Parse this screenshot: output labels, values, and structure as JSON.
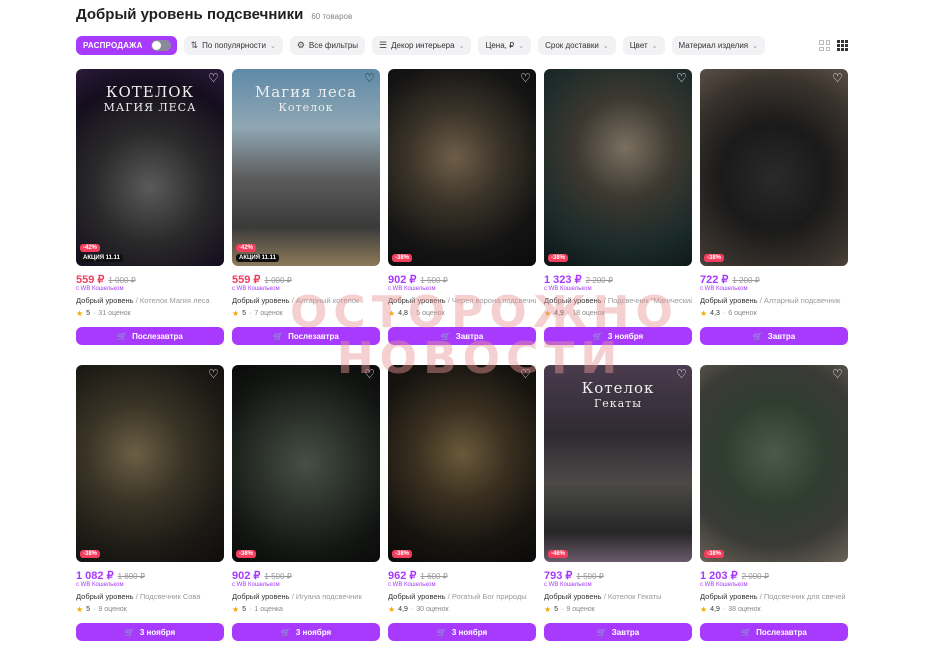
{
  "header": {
    "title": "Добрый уровень подсвечники",
    "count": "60 товаров"
  },
  "filters": {
    "sale_label": "РАСПРОДАЖА",
    "items": [
      {
        "label": "По популярности",
        "icon": "sort-icon"
      },
      {
        "label": "Все фильтры",
        "icon": "filter-icon"
      },
      {
        "label": "Декор интерьера",
        "icon": "list-icon"
      },
      {
        "label": "Цена, ₽",
        "icon": ""
      },
      {
        "label": "Срок доставки",
        "icon": ""
      },
      {
        "label": "Цвет",
        "icon": ""
      },
      {
        "label": "Материал изделия",
        "icon": ""
      }
    ]
  },
  "wallet_label": "с WB Кошельком",
  "products": [
    {
      "price": "559 ₽",
      "old": "1 000 ₽",
      "red": true,
      "discount": "-42%",
      "promo": "АКЦИЯ 11.11",
      "brand": "Добрый уровень",
      "name": "Котелок Магия леса",
      "rating": "5",
      "reviews": "31 оценок",
      "button": "Послезавтра",
      "photo_text": [
        "КОТЕЛОК",
        "МАГИЯ ЛЕСА"
      ],
      "bg": "radial-gradient(circle at 50% 60%,#5a5a5a 0%,#2a2a2a 40%,#150e1e 75%,#2b1a3a 100%)"
    },
    {
      "price": "559 ₽",
      "old": "1 000 ₽",
      "red": true,
      "discount": "-42%",
      "promo": "АКЦИЯ 11.11",
      "brand": "Добрый уровень",
      "name": "Алтарный котелок",
      "rating": "5",
      "reviews": "7 оценок",
      "button": "Послезавтра",
      "photo_text": [
        "Магия леса",
        "Котелок"
      ],
      "bg": "linear-gradient(180deg,#5f8aa8 0%,#8fa7b3 30%,#5d5d5d 55%,#3a3a3a 80%,#8d7a5a 100%)"
    },
    {
      "price": "902 ₽",
      "old": "1 500 ₽",
      "red": false,
      "discount": "-38%",
      "promo": "",
      "brand": "Добрый уровень",
      "name": "Череп ворона подсвечник",
      "rating": "4,8",
      "reviews": "5 оценок",
      "button": "Завтра",
      "photo_text": [],
      "bg": "radial-gradient(circle at 45% 45%,#6e5e48 0%,#3a3328 35%,#141414 70%,#0b0b0b 100%)"
    },
    {
      "price": "1 323 ₽",
      "old": "2 200 ₽",
      "red": false,
      "discount": "-38%",
      "promo": "",
      "brand": "Добрый уровень",
      "name": "Подсвечник \"Магический\"",
      "rating": "4,9",
      "reviews": "18 оценок",
      "button": "3 ноября",
      "photo_text": [],
      "bg": "radial-gradient(circle at 55% 40%,#7a7060 0%,#3c3830 35%,#1b2a2a 70%,#0d1414 100%)"
    },
    {
      "price": "722 ₽",
      "old": "1 200 ₽",
      "red": false,
      "discount": "-38%",
      "promo": "",
      "brand": "Добрый уровень",
      "name": "Алтарный подсвечник",
      "rating": "4,3",
      "reviews": "6 оценок",
      "button": "Завтра",
      "photo_text": [],
      "bg": "radial-gradient(circle at 50% 55%,#2a2a2a 0%,#1a1a1a 40%,#3a332d 75%,#5a5048 100%)"
    },
    {
      "price": "1 082 ₽",
      "old": "1 800 ₽",
      "red": false,
      "discount": "-38%",
      "promo": "",
      "brand": "Добрый уровень",
      "name": "Подсвечник Сова",
      "rating": "5",
      "reviews": "9 оценок",
      "button": "3 ноября",
      "photo_text": [],
      "bg": "radial-gradient(circle at 40% 45%,#6b5f45 0%,#3a3426 35%,#1c1a15 70%,#0e0d0b 100%)"
    },
    {
      "price": "902 ₽",
      "old": "1 500 ₽",
      "red": false,
      "discount": "-38%",
      "promo": "",
      "brand": "Добрый уровень",
      "name": "Игуана подсвечник",
      "rating": "5",
      "reviews": "1 оценка",
      "button": "3 ноября",
      "photo_text": [],
      "bg": "radial-gradient(circle at 50% 50%,#465044 0%,#2a3029 40%,#121512 75%,#0a0a0a 100%)"
    },
    {
      "price": "962 ₽",
      "old": "1 600 ₽",
      "red": false,
      "discount": "-38%",
      "promo": "",
      "brand": "Добрый уровень",
      "name": "Рогатый Бог природы",
      "rating": "4,9",
      "reviews": "30 оценок",
      "button": "3 ноября",
      "photo_text": [],
      "bg": "radial-gradient(circle at 50% 45%,#6a5a3a 0%,#3a3020 35%,#171410 70%,#0b0a08 100%)"
    },
    {
      "price": "793 ₽",
      "old": "1 500 ₽",
      "red": false,
      "discount": "-46%",
      "promo": "",
      "brand": "Добрый уровень",
      "name": "Котелок Гекаты",
      "rating": "5",
      "reviews": "9 оценок",
      "button": "Завтра",
      "photo_text": [
        "Котелок",
        "Гекаты"
      ],
      "bg": "linear-gradient(180deg,#4a3c4e 0%,#2f2a32 35%,#4b4a48 60%,#262626 85%,#6a5a6a 100%)"
    },
    {
      "price": "1 203 ₽",
      "old": "2 000 ₽",
      "red": false,
      "discount": "-38%",
      "promo": "",
      "brand": "Добрый уровень",
      "name": "Подсвечник для свечей",
      "rating": "4,9",
      "reviews": "38 оценок",
      "button": "Послезавтра",
      "photo_text": [],
      "bg": "radial-gradient(circle at 50% 45%,#4a5a4a 0%,#2f3d30 40%,#3a3a36 70%,#6a6258 100%)"
    }
  ],
  "watermark": [
    "ОСТОРОЖНО",
    "НОВОСТИ"
  ]
}
